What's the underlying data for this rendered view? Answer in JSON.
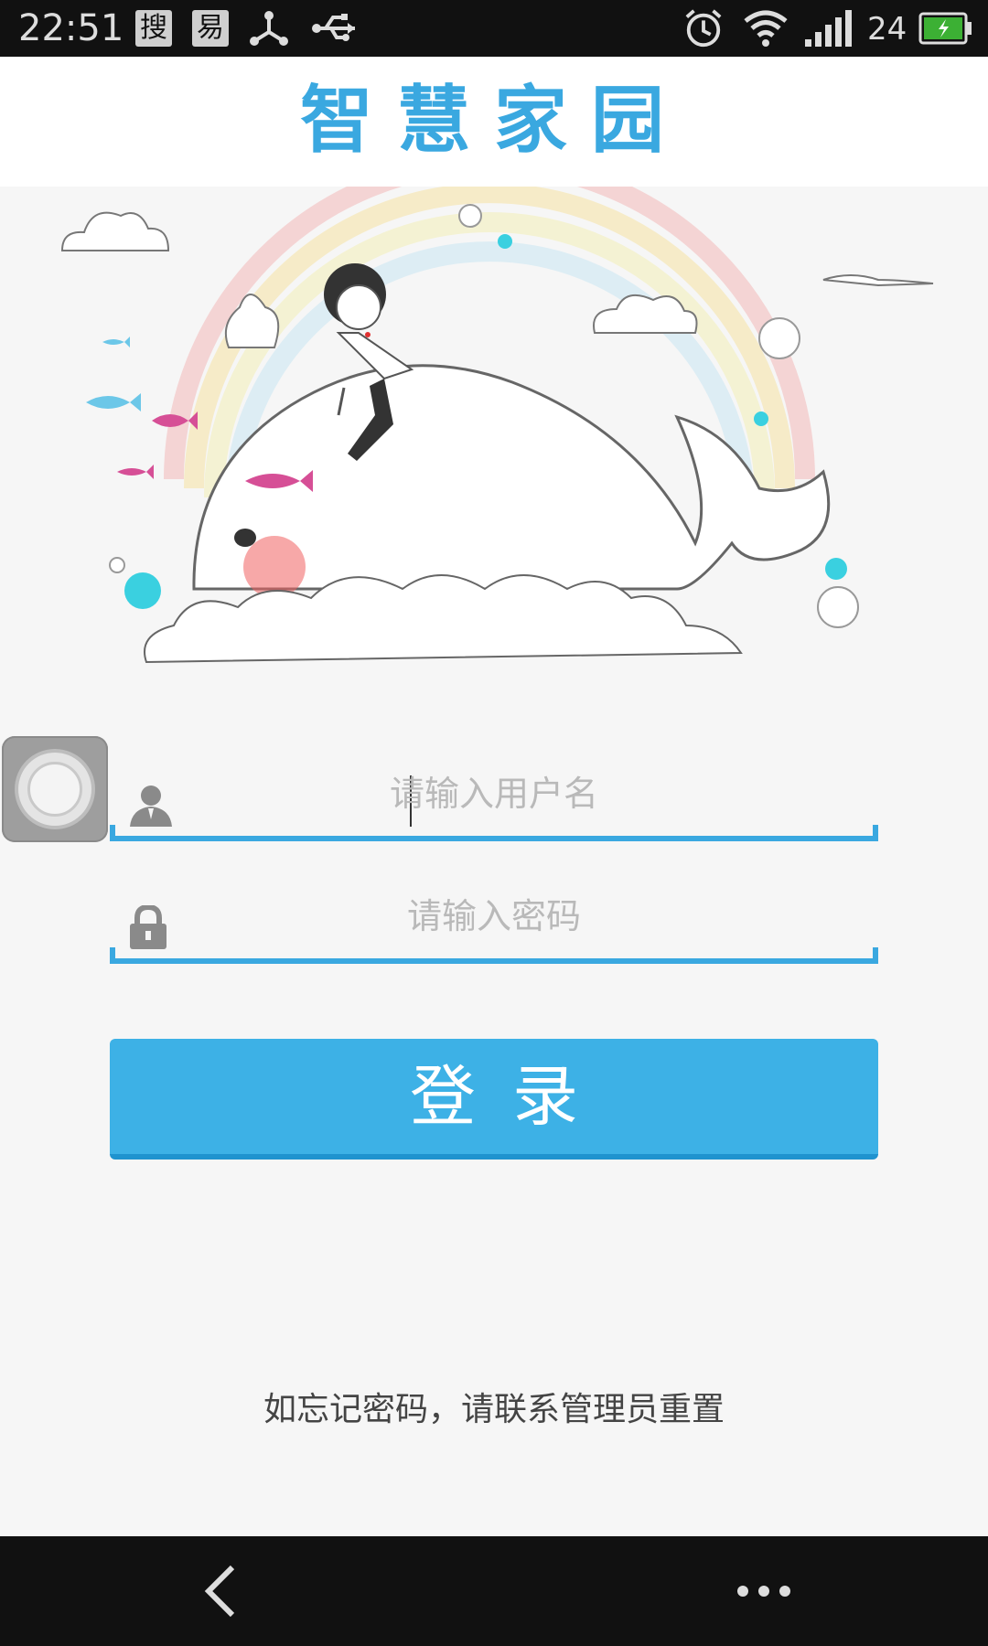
{
  "status_bar": {
    "time": "22:51",
    "notif_1": "搜",
    "notif_2": "易",
    "signal_label": "24",
    "icons": [
      "sogou-icon",
      "yi-icon",
      "share-icon",
      "usb-icon",
      "alarm-icon",
      "wifi-icon",
      "signal-icon",
      "battery-icon"
    ]
  },
  "header": {
    "title": "智慧家园"
  },
  "form": {
    "username_placeholder": "请输入用户名",
    "password_placeholder": "请输入密码",
    "login_label": "登录",
    "accent_color": "#3aa8e0"
  },
  "footer": {
    "hint": "如忘记密码，请联系管理员重置"
  },
  "nav": {
    "icons": [
      "back-icon",
      "more-icon"
    ]
  }
}
